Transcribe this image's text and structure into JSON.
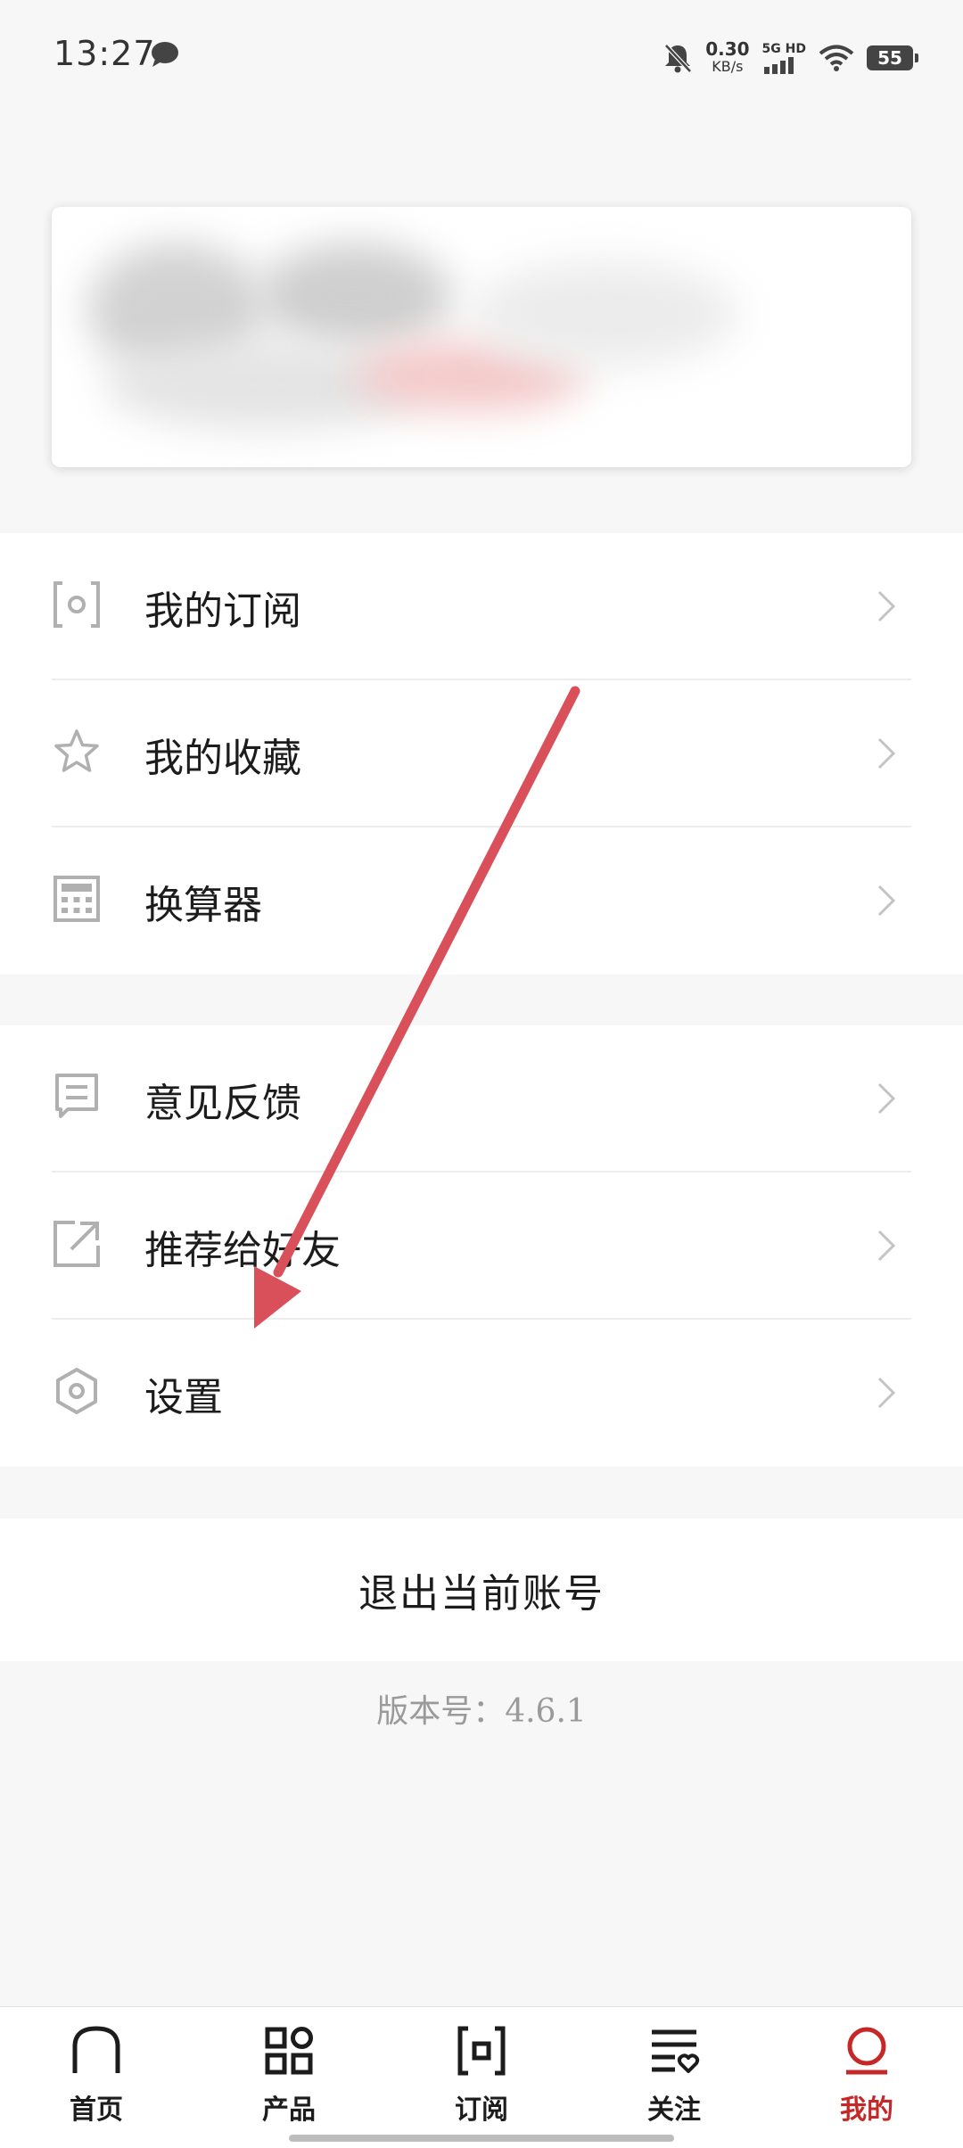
{
  "status_bar": {
    "time": "13:27",
    "net_speed_value": "0.30",
    "net_speed_unit": "KB/s",
    "network_label": "5G HD",
    "battery": "55"
  },
  "menu_group_1": [
    {
      "label": "我的订阅",
      "icon": "subscription-icon"
    },
    {
      "label": "我的收藏",
      "icon": "star-icon"
    },
    {
      "label": "换算器",
      "icon": "calculator-icon"
    }
  ],
  "menu_group_2": [
    {
      "label": "意见反馈",
      "icon": "feedback-icon"
    },
    {
      "label": "推荐给好友",
      "icon": "share-icon"
    },
    {
      "label": "设置",
      "icon": "settings-icon"
    }
  ],
  "logout_label": "退出当前账号",
  "version": "版本号：4.6.1",
  "bottom_nav": [
    {
      "label": "首页",
      "icon": "home-icon"
    },
    {
      "label": "产品",
      "icon": "grid-icon"
    },
    {
      "label": "订阅",
      "icon": "subscription-icon"
    },
    {
      "label": "关注",
      "icon": "follow-list-icon"
    },
    {
      "label": "我的",
      "icon": "profile-icon",
      "active": true
    }
  ],
  "colors": {
    "accent": "#c62828",
    "annotation_arrow": "#d9505a",
    "background": "#f7f7f7",
    "icon_gray": "#b0b0b0"
  }
}
